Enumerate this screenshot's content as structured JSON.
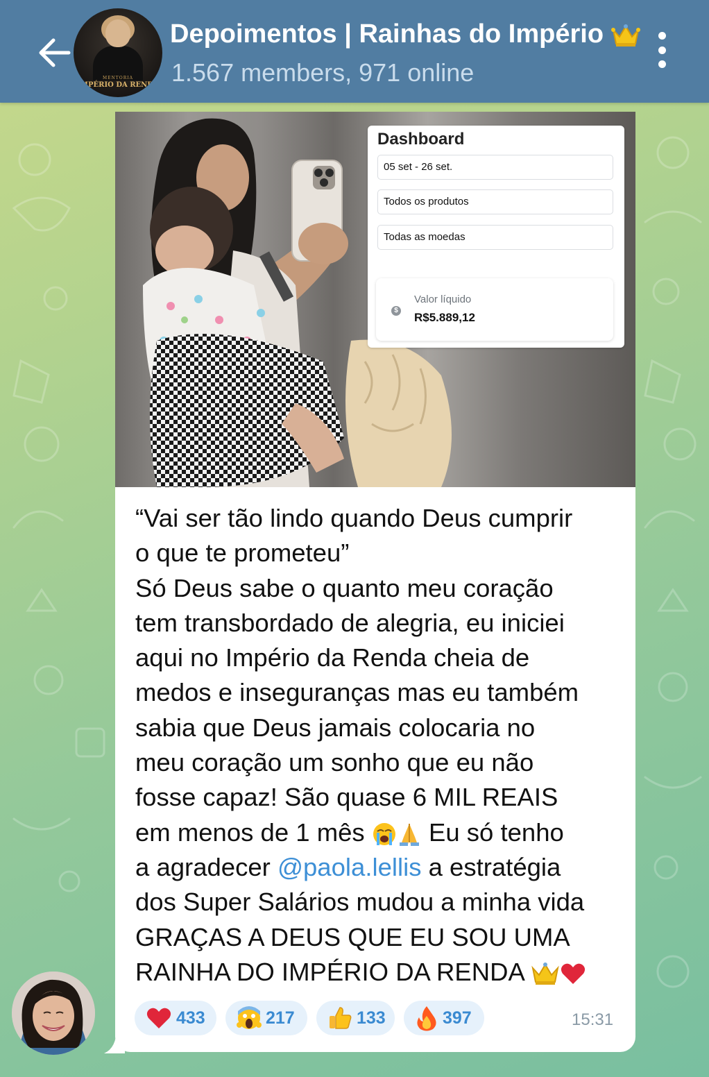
{
  "header": {
    "chat_title": "Depoimentos | Rainhas do Império",
    "title_emoji": "crown",
    "status": "1.567 members, 971 online",
    "avatar_text_top": "MENTORIA",
    "avatar_text_main": "IMPÉRIO DA RENDA",
    "back_icon": "arrow-left-icon",
    "menu_icon": "more-vertical-icon"
  },
  "colors": {
    "header_bg": "#517da2",
    "link": "#3d8fd6",
    "reaction_bg": "#e6f1fb",
    "reaction_count": "#3a8ad1"
  },
  "message": {
    "image_overlay": {
      "title": "Dashboard",
      "date_range": "05 set - 26 set.",
      "product_filter": "Todos os produtos",
      "currency_filter": "Todas as moedas",
      "net_label": "Valor líquido",
      "net_value": "R$5.889,12",
      "coin_symbol": "$"
    },
    "lines": [
      "“Vai ser tão lindo quando Deus cumprir",
      "o que te prometeu”",
      "Só Deus sabe o quanto meu coração",
      "tem transbordado de alegria, eu iniciei",
      "aqui no Império da Renda cheia de",
      "medos e inseguranças mas eu também",
      "sabia que Deus jamais colocaria no",
      "meu coração um sonho que eu não",
      "fosse capaz! São quase 6 MIL REAIS",
      "em menos de 1 mês",
      " Eu só tenho",
      "a agradecer ",
      "@paola.lellis",
      " a estratégia",
      "dos Super Salários mudou a minha vida",
      "GRAÇAS A DEUS QUE EU SOU UMA",
      "RAINHA DO IMPÉRIO DA RENDA"
    ],
    "line_emojis": {
      "line10": [
        "loudly-crying-face",
        "folded-hands"
      ],
      "last_line": [
        "crown",
        "red-heart"
      ]
    },
    "reactions": [
      {
        "emoji": "red-heart",
        "count": "433"
      },
      {
        "emoji": "face-screaming",
        "count": "217"
      },
      {
        "emoji": "thumbs-up",
        "count": "133"
      },
      {
        "emoji": "fire",
        "count": "397"
      }
    ],
    "time": "15:31"
  }
}
